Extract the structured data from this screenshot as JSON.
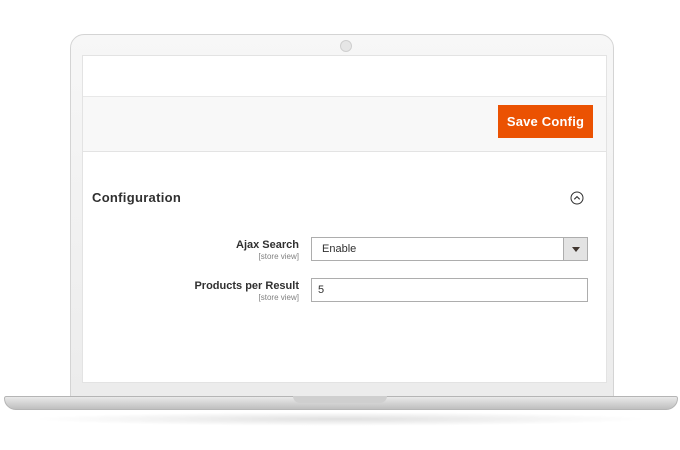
{
  "toolbar": {
    "save_label": "Save Config"
  },
  "section": {
    "title": "Configuration",
    "collapse_icon": "chevron-up-circle-icon"
  },
  "fields": {
    "ajax_search": {
      "label": "Ajax Search",
      "scope": "[store view]",
      "value": "Enable"
    },
    "products_per_result": {
      "label": "Products per Result",
      "scope": "[store view]",
      "value": "5"
    }
  },
  "colors": {
    "accent": "#eb5202",
    "text": "#303030"
  }
}
